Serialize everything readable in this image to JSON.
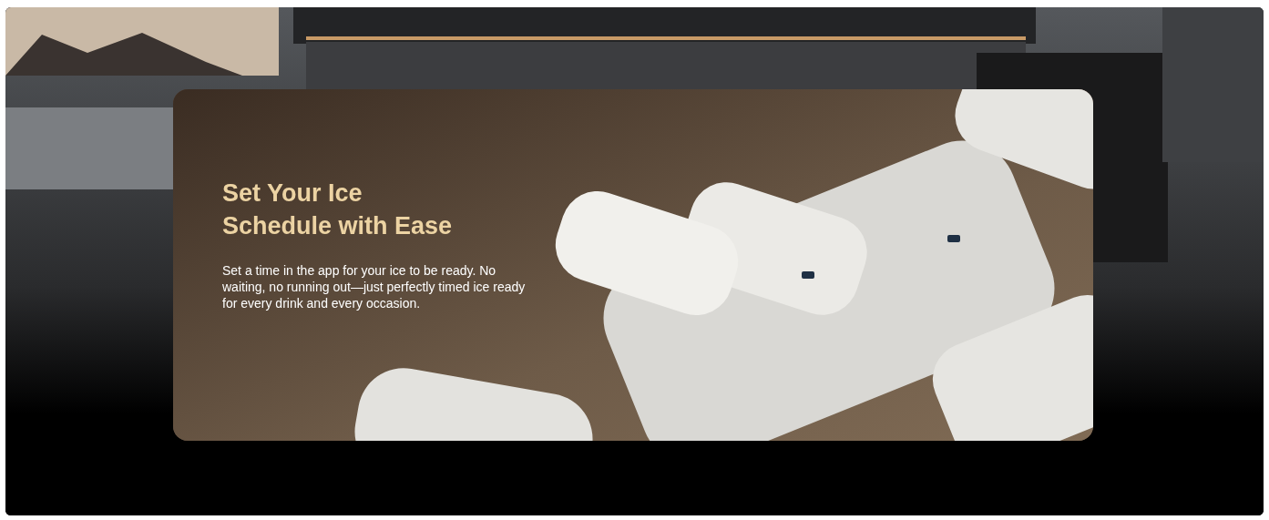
{
  "feature_card": {
    "heading": "Set Your Ice Schedule with Ease",
    "description": "Set a time in the app for your ice to be ready. No waiting, no running out—just perfectly timed ice ready for every drink and every occasion."
  }
}
